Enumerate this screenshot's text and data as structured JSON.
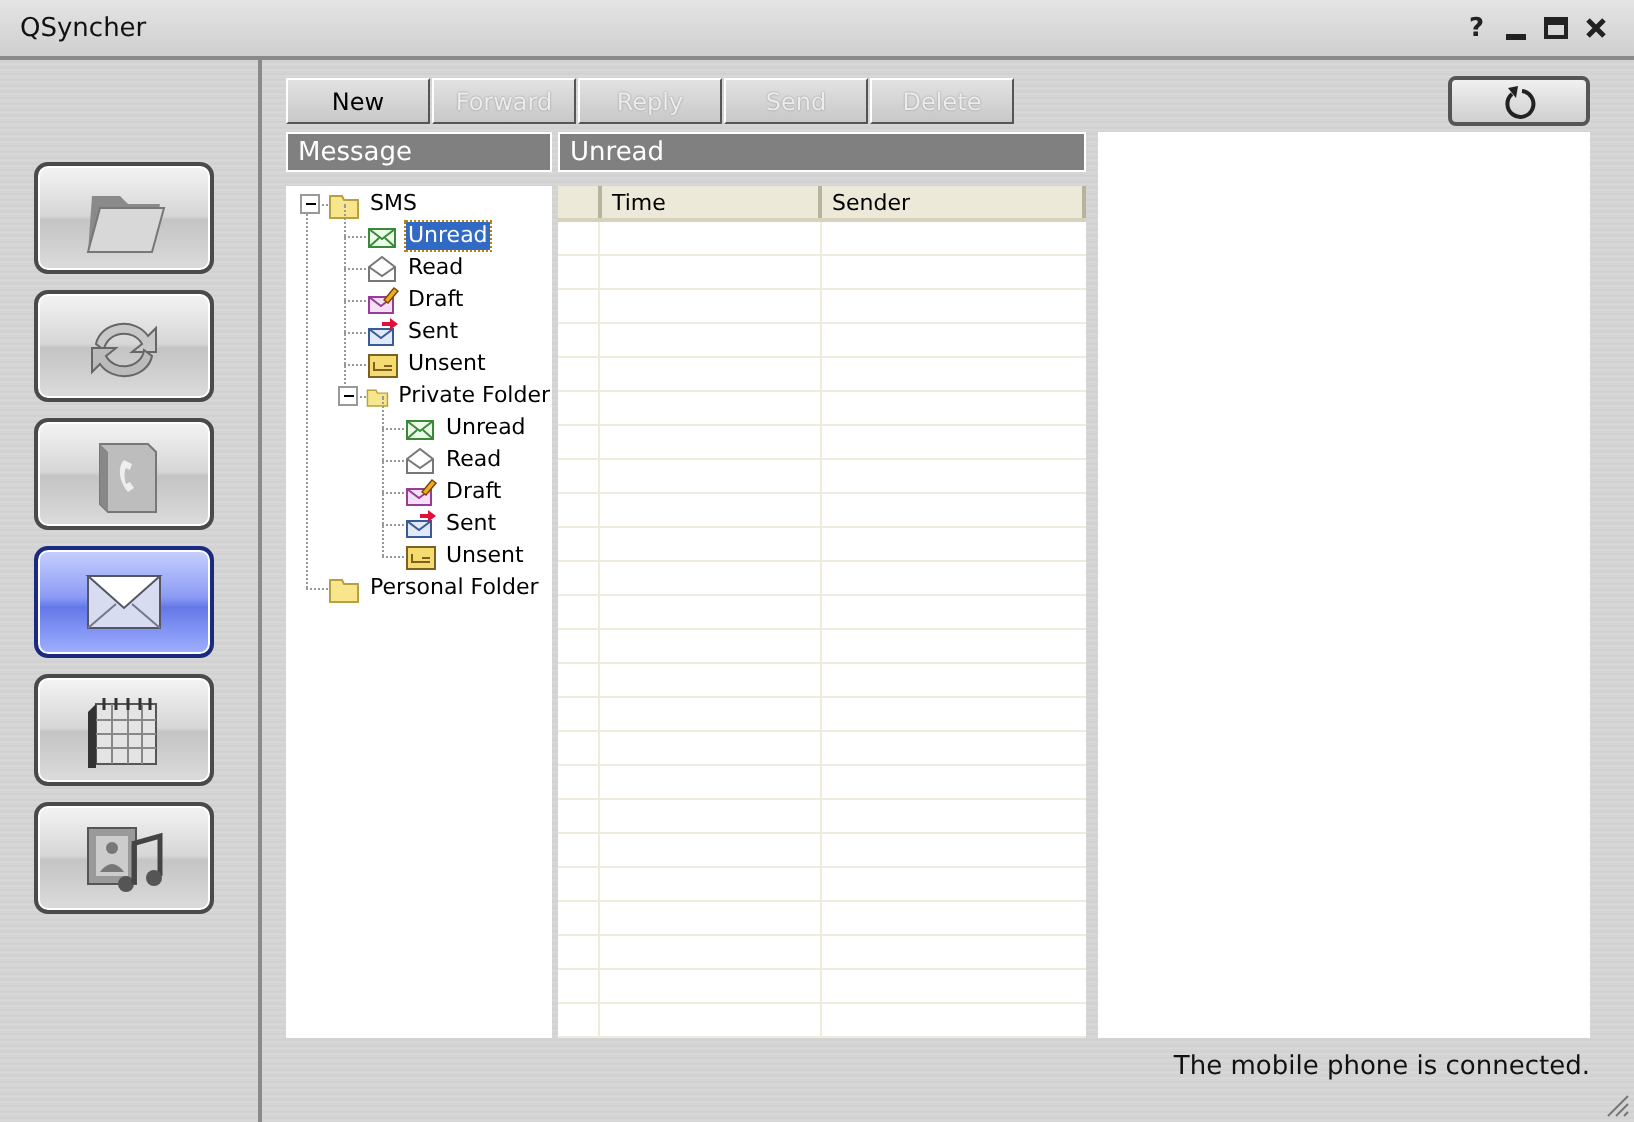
{
  "window": {
    "title": "QSyncher",
    "help": "?"
  },
  "sidebar": {
    "items": [
      {
        "kind": "folder",
        "selected": false
      },
      {
        "kind": "sync",
        "selected": false
      },
      {
        "kind": "phonebook",
        "selected": false
      },
      {
        "kind": "message",
        "selected": true
      },
      {
        "kind": "calendar",
        "selected": false
      },
      {
        "kind": "media",
        "selected": false
      }
    ]
  },
  "toolbar": {
    "buttons": [
      {
        "label": "New",
        "disabled": false
      },
      {
        "label": "Forward",
        "disabled": true
      },
      {
        "label": "Reply",
        "disabled": true
      },
      {
        "label": "Send",
        "disabled": true
      },
      {
        "label": "Delete",
        "disabled": true
      }
    ]
  },
  "tree": {
    "title": "Message",
    "items": [
      {
        "label": "SMS",
        "kind": "folder",
        "selected": false,
        "expanded": true,
        "children": [
          {
            "label": "Unread",
            "kind": "unread",
            "selected": true
          },
          {
            "label": "Read",
            "kind": "read",
            "selected": false
          },
          {
            "label": "Draft",
            "kind": "draft",
            "selected": false
          },
          {
            "label": "Sent",
            "kind": "sent",
            "selected": false
          },
          {
            "label": "Unsent",
            "kind": "unsent",
            "selected": false
          },
          {
            "label": "Private Folder",
            "kind": "folder",
            "selected": false,
            "expanded": true,
            "children": [
              {
                "label": "Unread",
                "kind": "unread",
                "selected": false
              },
              {
                "label": "Read",
                "kind": "read",
                "selected": false
              },
              {
                "label": "Draft",
                "kind": "draft",
                "selected": false
              },
              {
                "label": "Sent",
                "kind": "sent",
                "selected": false
              },
              {
                "label": "Unsent",
                "kind": "unsent",
                "selected": false
              }
            ]
          }
        ]
      },
      {
        "label": "Personal Folder",
        "kind": "folder",
        "selected": false
      }
    ]
  },
  "list": {
    "title": "Unread",
    "columns": [
      "Time",
      "Sender"
    ]
  },
  "status_bar": {
    "text": "The mobile phone is connected."
  }
}
